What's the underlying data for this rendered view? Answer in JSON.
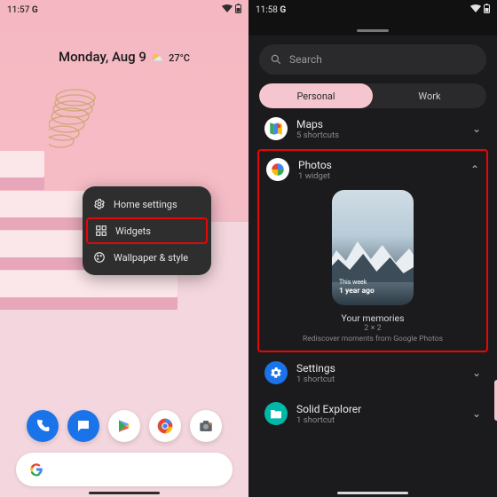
{
  "left": {
    "status": {
      "time": "11:57",
      "google": "G"
    },
    "date": {
      "weekday": "Monday,",
      "md": "Aug 9",
      "weather": "⛅",
      "temp": "27°C"
    },
    "menu": {
      "settings": "Home settings",
      "widgets": "Widgets",
      "wallpaper": "Wallpaper & style"
    },
    "dock": [
      "Phone",
      "Messages",
      "Play Store",
      "Chrome",
      "Camera"
    ]
  },
  "right": {
    "status": {
      "time": "11:58",
      "google": "G"
    },
    "search_placeholder": "Search",
    "tabs": {
      "personal": "Personal",
      "work": "Work"
    },
    "apps": {
      "maps": {
        "name": "Maps",
        "sub": "5 shortcuts"
      },
      "photos": {
        "name": "Photos",
        "sub": "1 widget"
      },
      "settings": {
        "name": "Settings",
        "sub": "1 shortcut"
      },
      "explorer": {
        "name": "Solid Explorer",
        "sub": "1 shortcut"
      }
    },
    "widget": {
      "caption_top": "This week",
      "caption_main": "1 year ago",
      "title": "Your memories",
      "dim": "2 × 2",
      "desc": "Rediscover moments from Google Photos"
    }
  }
}
